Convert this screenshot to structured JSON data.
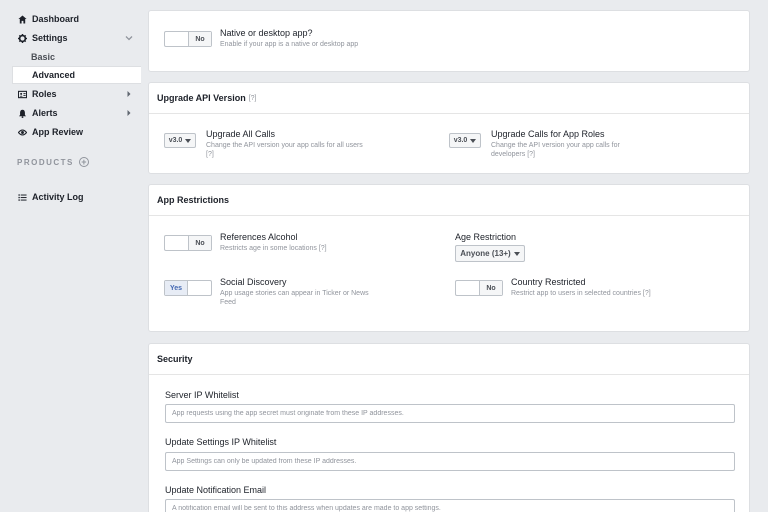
{
  "sidebar": {
    "dashboard": "Dashboard",
    "settings": "Settings",
    "basic": "Basic",
    "advanced": "Advanced",
    "roles": "Roles",
    "alerts": "Alerts",
    "app_review": "App Review",
    "products": "PRODUCTS",
    "activity_log": "Activity Log"
  },
  "native_app": {
    "title": "Native or desktop app?",
    "description": "Enable if your app is a native or desktop app",
    "toggle_label": "No"
  },
  "upgrade_api": {
    "header": "Upgrade API Version",
    "help": "[?]",
    "all_calls": {
      "version": "v3.0",
      "title": "Upgrade All Calls",
      "description": "Change the API version your app calls for all users",
      "help": "[?]"
    },
    "app_roles": {
      "version": "v3.0",
      "title": "Upgrade Calls for App Roles",
      "description": "Change the API version your app calls for developers",
      "help": "[?]"
    }
  },
  "app_restrictions": {
    "header": "App Restrictions",
    "alcohol": {
      "toggle_label": "No",
      "title": "References Alcohol",
      "description": "Restricts age in some locations",
      "help": "[?]"
    },
    "age": {
      "title": "Age Restriction",
      "value": "Anyone (13+)"
    },
    "social": {
      "toggle_label": "Yes",
      "title": "Social Discovery",
      "description": "App usage stories can appear in Ticker or News Feed"
    },
    "country": {
      "toggle_label": "No",
      "title": "Country Restricted",
      "description": "Restrict app to users in selected countries",
      "help": "[?]"
    }
  },
  "security": {
    "header": "Security",
    "server_ip": {
      "label": "Server IP Whitelist",
      "placeholder": "App requests using the app secret must originate from these IP addresses."
    },
    "settings_ip": {
      "label": "Update Settings IP Whitelist",
      "placeholder": "App Settings can only be updated from these IP addresses."
    },
    "notify_email": {
      "label": "Update Notification Email",
      "placeholder": "A notification email will be sent to this address when updates are made to app settings."
    }
  }
}
